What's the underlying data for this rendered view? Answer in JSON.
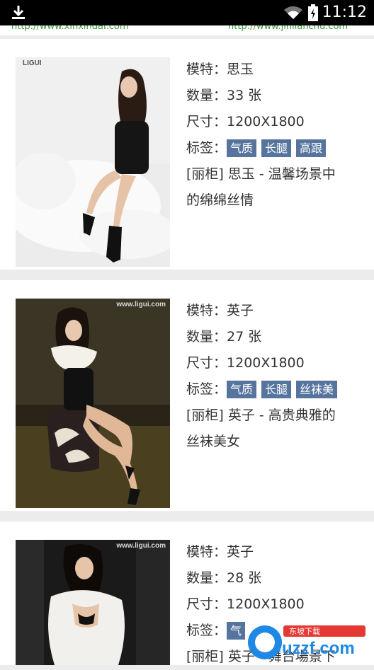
{
  "status": {
    "time": "11:12"
  },
  "urls": [
    "http://www.xinxindai.com",
    "http://www.jinlianchu.com"
  ],
  "cards": [
    {
      "watermark": "LIGUI",
      "model_label": "模特：",
      "model": "思玉",
      "count_label": "数量：",
      "count": "33 张",
      "size_label": "尺寸：",
      "size": "1200X1800",
      "tags_label": "标签：",
      "tags": [
        "气质",
        "长腿",
        "高跟"
      ],
      "desc": "[丽柜] 思玉 - 温馨场景中的绵绵丝情"
    },
    {
      "watermark": "www.ligui.com",
      "model_label": "模特：",
      "model": "英子",
      "count_label": "数量：",
      "count": "27 张",
      "size_label": "尺寸：",
      "size": "1200X1800",
      "tags_label": "标签：",
      "tags": [
        "气质",
        "长腿",
        "丝袜美"
      ],
      "desc": "[丽柜] 英子 - 高贵典雅的丝袜美女"
    },
    {
      "watermark": "www.ligui.com",
      "model_label": "模特：",
      "model": "英子",
      "count_label": "数量：",
      "count": "28 张",
      "size_label": "尺寸：",
      "size": "1200X1800",
      "tags_label": "标签：",
      "tags": [
        "气",
        "",
        ""
      ],
      "desc": "[丽柜] 英子 - 舞台場景下"
    }
  ],
  "brand_logo": {
    "text": "uzzf.com",
    "sub": "东坡下载"
  }
}
